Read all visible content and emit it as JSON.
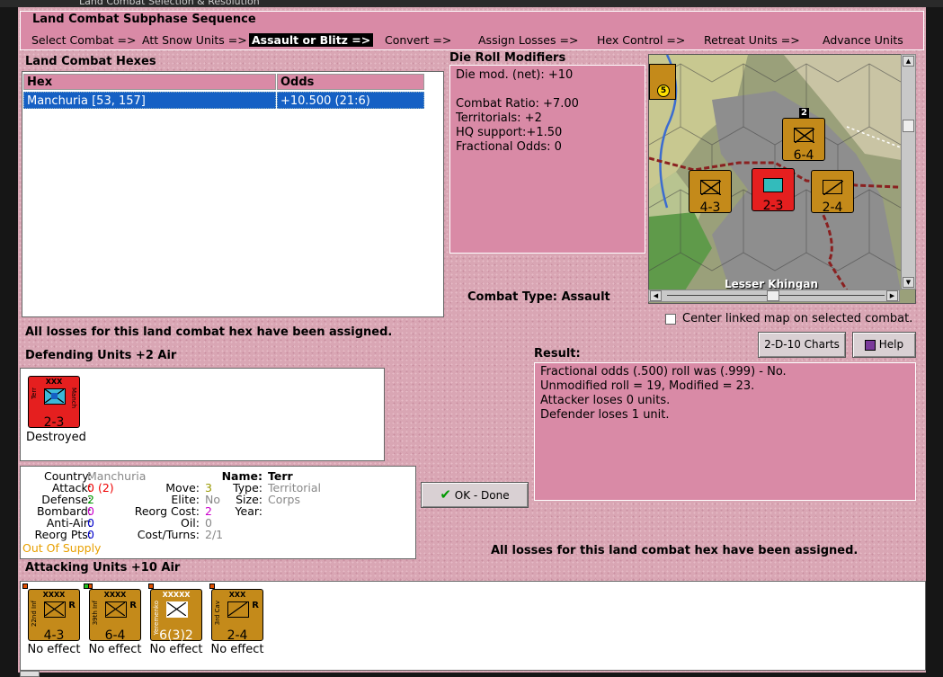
{
  "window": {
    "title": "Land Combat Selection & Resolution"
  },
  "sequence": {
    "title": "Land Combat Subphase Sequence",
    "steps": [
      "Select Combat =>",
      "Att Snow Units =>",
      "Assault or Blitz =>",
      "Convert =>",
      "Assign Losses =>",
      "Hex Control =>",
      "Retreat Units =>",
      "Advance Units"
    ],
    "active_index": 2
  },
  "hexes": {
    "label": "Land Combat Hexes",
    "col_hex": "Hex",
    "col_odds": "Odds",
    "rows": [
      {
        "hex": "Manchuria [53, 157]",
        "odds": "+10.500 (21:6)"
      }
    ]
  },
  "losses_msg": "All losses for this land combat hex have been assigned.",
  "die_roll": {
    "label": "Die Roll Modifiers",
    "lines": [
      "Die mod. (net): +10",
      "",
      "Combat Ratio: +7.00",
      "Territorials: +2",
      "HQ support:+1.50",
      "Fractional Odds: 0"
    ]
  },
  "combat_type": {
    "label": "Combat Type:",
    "value": "Assault"
  },
  "map": {
    "place_label": "Lesser Khingan",
    "units": [
      {
        "id": "m1",
        "name": "2-3",
        "side": "",
        "size": "XXX",
        "type": "territorial",
        "color": "#e51f1f"
      },
      {
        "id": "m2",
        "name": "4-3",
        "side": "22nd Inf",
        "size": "XXXX",
        "type": "infantry",
        "color": "#c48a1a"
      },
      {
        "id": "m3",
        "name": "6-4",
        "side": "39th Inf",
        "size": "XXXX",
        "type": "infantry",
        "color": "#c48a1a"
      },
      {
        "id": "m4",
        "name": "2-4",
        "side": "3rd Cav",
        "size": "XXX",
        "type": "cavalry",
        "color": "#c48a1a"
      }
    ],
    "stack_count": "2",
    "badge": "5"
  },
  "center_linked": {
    "label": "Center linked map on selected combat.",
    "checked": false
  },
  "buttons": {
    "charts": "2-D-10 Charts",
    "help": "Help",
    "ok": "OK - Done"
  },
  "defending": {
    "label": "Defending Units +2 Air",
    "units": [
      {
        "name": "2-3",
        "size": "XXX",
        "side": "Terr",
        "side2": "Manch",
        "status": "Destroyed",
        "color": "#e51f1f",
        "type": "territorial"
      }
    ]
  },
  "result": {
    "label": "Result:",
    "lines": [
      "Fractional odds (.500) roll was (.999)  - No.",
      "Unmodified roll = 19, Modified = 23.",
      "Attacker loses 0 units.",
      "Defender loses 1 unit."
    ]
  },
  "unit_info": {
    "country_k": "Country:",
    "country_v": "Manchuria",
    "attack_k": "Attack:",
    "attack_v": "0",
    "attack_v2": "(2)",
    "defense_k": "Defense:",
    "defense_v": "2",
    "bombard_k": "Bombard:",
    "bombard_v": "0",
    "antiair_k": "Anti-Air:",
    "antiair_v": "0",
    "reorgpts_k": "Reorg Pts:",
    "reorgpts_v": "0",
    "supply": "Out Of Supply",
    "move_k": "Move:",
    "move_v": "3",
    "elite_k": "Elite:",
    "elite_v": "No",
    "reorgcost_k": "Reorg Cost:",
    "reorgcost_v": "2",
    "oil_k": "Oil:",
    "oil_v": "0",
    "costturns_k": "Cost/Turns:",
    "costturns_v": "2/1",
    "name_k": "Name:",
    "name_v": "Terr",
    "type_k": "Type:",
    "type_v": "Territorial",
    "size_k": "Size:",
    "size_v": "Corps",
    "year_k": "Year:",
    "year_v": ""
  },
  "attacking": {
    "label": "Attacking Units +10 Air",
    "units": [
      {
        "name": "4-3",
        "side": "22nd Inf",
        "size": "XXXX",
        "status": "No effect",
        "color": "#c48a1a",
        "type": "infantry",
        "reserve": "R"
      },
      {
        "name": "6-4",
        "side": "39th Inf",
        "size": "XXXX",
        "status": "No effect",
        "color": "#c48a1a",
        "type": "infantry",
        "reserve": "R"
      },
      {
        "name": "6(3)2",
        "side": "Yeremenko",
        "size": "XXXXX",
        "status": "No effect",
        "color": "#c48a1a",
        "type": "hq",
        "reserve": ""
      },
      {
        "name": "2-4",
        "side": "3rd Cav",
        "size": "XXX",
        "status": "No effect",
        "color": "#c48a1a",
        "type": "cavalry",
        "reserve": "R"
      }
    ]
  }
}
